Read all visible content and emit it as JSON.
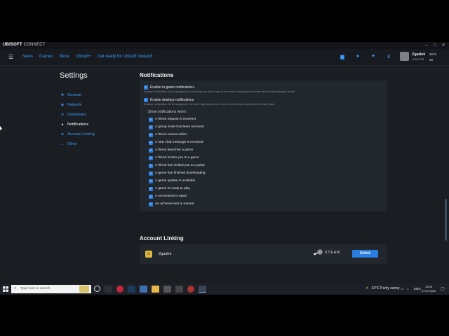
{
  "app": {
    "brand_bold": "UBISOFT",
    "brand_rest": " CONNECT"
  },
  "nav": {
    "links": [
      "News",
      "Games",
      "Store",
      "Ubisoft+",
      "Get ready for Ubisoft forward!"
    ],
    "icons": [
      "chat-icon",
      "friends-icon",
      "wishlist-icon",
      "cart-icon"
    ]
  },
  "user": {
    "name": "Zgadek",
    "level": "Level 24",
    "units": "6575",
    "coins": "60"
  },
  "settings": {
    "title": "Settings",
    "sidebar": [
      "General",
      "Network",
      "Downloads",
      "Notifications",
      "Account Linking",
      "Other"
    ],
    "active_index": 3
  },
  "notifications": {
    "title": "Notifications",
    "ingame_label": "Enable in-game notifications",
    "ingame_desc": "In-game notifications will be displayed as a small pop-up at the edge of the screen, keeping you informed without interrupting the action.",
    "desktop_label": "Enable desktop notifications",
    "desktop_desc": "Desktop notifications will be displayed in the lower right-hand corner of your screen when important events take place.",
    "show_when": "Show notifications when:",
    "items": [
      "A friend request is received",
      "A group invite has been received",
      "A friend comes online",
      "A new chat message is received",
      "A friend launches a game",
      "A friend invites you to a game",
      "A friend has invited you to a party",
      "A game has finished downloading",
      "A game update is available",
      "A game is ready to play",
      "A screenshot is taken",
      "An achievement is earned"
    ]
  },
  "account_linking": {
    "title": "Account Linking",
    "username": "Zgadek",
    "platform": "STEAM",
    "unlink_label": "Unlink"
  },
  "taskbar": {
    "search_placeholder": "Type here to search",
    "weather": "23°C  Partly sunny",
    "lang": "ENG",
    "time": "13:49",
    "date": "07.07.2022"
  },
  "colors": {
    "accent": "#3d9dff",
    "button": "#2a7de1",
    "background": "#1a1d22",
    "panel": "#22262d"
  }
}
